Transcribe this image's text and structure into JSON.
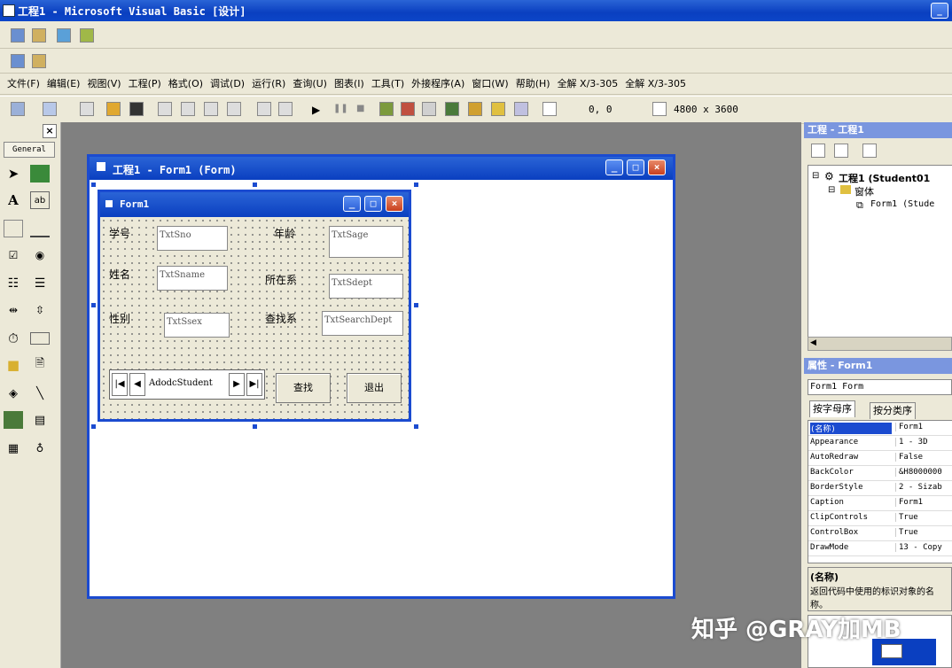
{
  "app": {
    "title": "工程1 - Microsoft Visual Basic [设计]"
  },
  "menu": [
    "文件(F)",
    "编辑(E)",
    "视图(V)",
    "工程(P)",
    "格式(O)",
    "调试(D)",
    "运行(R)",
    "查询(U)",
    "图表(I)",
    "工具(T)",
    "外接程序(A)",
    "窗口(W)",
    "帮助(H)",
    "全解 X/3-305",
    "全解 X/3-305"
  ],
  "toolbar": {
    "position": "0, 0",
    "size": "4800 x 3600"
  },
  "toolbox": {
    "general_label": "General"
  },
  "designer": {
    "title": "工程1 - Form1 (Form)"
  },
  "form": {
    "title": "Form1",
    "labels": {
      "sno": "学号",
      "sage": "年龄",
      "sname": "姓名",
      "sdept": "所在系",
      "ssex": "性别",
      "search": "查找系"
    },
    "textboxes": {
      "sno": "TxtSno",
      "sage": "TxtSage",
      "sname": "TxtSname",
      "sdept": "TxtSdept",
      "ssex": "TxtSsex",
      "searchdept": "TxtSearchDept"
    },
    "adodc": "AdodcStudent",
    "buttons": {
      "find": "查找",
      "exit": "退出"
    }
  },
  "project": {
    "title": "工程 - 工程1",
    "root": "工程1 (Student01",
    "folder": "窗体",
    "item": "Form1 (Stude"
  },
  "properties": {
    "title": "属性 - Form1",
    "object": "Form1 Form",
    "tabs": [
      "按字母序",
      "按分类序"
    ],
    "rows": [
      {
        "k": "(名称)",
        "v": "Form1"
      },
      {
        "k": "Appearance",
        "v": "1 - 3D"
      },
      {
        "k": "AutoRedraw",
        "v": "False"
      },
      {
        "k": "BackColor",
        "v": "&H8000000"
      },
      {
        "k": "BorderStyle",
        "v": "2 - Sizab"
      },
      {
        "k": "Caption",
        "v": "Form1"
      },
      {
        "k": "ClipControls",
        "v": "True"
      },
      {
        "k": "ControlBox",
        "v": "True"
      },
      {
        "k": "DrawMode",
        "v": "13 - Copy"
      }
    ],
    "desc_title": "(名称)",
    "desc_text": "返回代码中使用的标识对象的名称。"
  },
  "watermark": "知乎 @GRAY加MB"
}
